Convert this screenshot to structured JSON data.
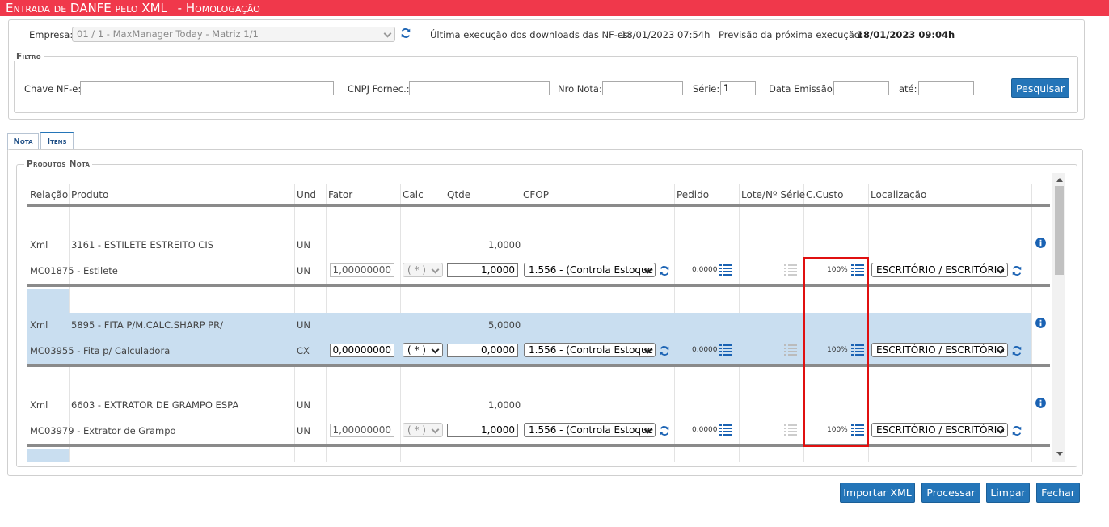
{
  "window": {
    "title": "Entrada de DANFE pelo XML",
    "env": "- Homologação"
  },
  "header": {
    "empresa_label": "Empresa:",
    "empresa_value": "01 / 1 - MaxManager Today - Matriz 1/1",
    "ultima_label": "Última execução dos downloads das NF-es:",
    "ultima_value": "18/01/2023 07:54h",
    "previsao_label": "Previsão da próxima execução:",
    "previsao_value": "18/01/2023 09:04h"
  },
  "filtro": {
    "legend": "Filtro",
    "chave_label": "Chave NF-e:",
    "chave_value": "",
    "cnpj_label": "CNPJ Fornec.:",
    "cnpj_value": "",
    "nro_label": "Nro Nota:",
    "nro_value": "",
    "serie_label": "Série:",
    "serie_value": "1",
    "data_label": "Data Emissão:",
    "data_value": "",
    "ate_label": "até:",
    "ate_value": "",
    "search_button": "Pesquisar"
  },
  "tabs": [
    {
      "label": "Nota",
      "active": false
    },
    {
      "label": "Itens",
      "active": true
    }
  ],
  "produtos": {
    "legend": "Produtos Nota",
    "columns": [
      "Relação",
      "Produto",
      "Und",
      "Fator",
      "Calc",
      "Qtde",
      "CFOP",
      "Pedido",
      "Lote/Nº Série",
      "C.Custo",
      "Localização"
    ],
    "items": [
      {
        "xml_relacao": "Xml",
        "xml_produto": "3161 - ESTILETE ESTREITO CIS",
        "xml_und": "UN",
        "xml_qtde": "1,0000",
        "rel": "MC01875 - Estilete",
        "und": "UN",
        "fator": "1,00000000",
        "calc": "( * )",
        "calc_disabled": true,
        "qtde": "1,0000",
        "cfop": "1.556 - (Controla Estoque",
        "pedido": "0,0000",
        "ccusto": "100%",
        "localizacao": "ESCRITÓRIO / ESCRITÓRIO",
        "highlight": false
      },
      {
        "xml_relacao": "Xml",
        "xml_produto": "5895 - FITA P/M.CALC.SHARP PR/",
        "xml_und": "UN",
        "xml_qtde": "5,0000",
        "rel": "MC03955 - Fita p/ Calculadora",
        "und": "CX",
        "fator": "0,00000000",
        "calc": "( * )",
        "calc_disabled": false,
        "qtde": "0,0000",
        "cfop": "1.556 - (Controla Estoque",
        "pedido": "0,0000",
        "ccusto": "100%",
        "localizacao": "ESCRITÓRIO / ESCRITÓRIO",
        "highlight": true
      },
      {
        "xml_relacao": "Xml",
        "xml_produto": "6603 - EXTRATOR DE GRAMPO ESPA",
        "xml_und": "UN",
        "xml_qtde": "1,0000",
        "rel": "MC03979 - Extrator de Grampo",
        "und": "UN",
        "fator": "1,00000000",
        "calc": "( * )",
        "calc_disabled": true,
        "qtde": "1,0000",
        "cfop": "1.556 - (Controla Estoque",
        "pedido": "0,0000",
        "ccusto": "100%",
        "localizacao": "ESCRITÓRIO / ESCRITÓRIO",
        "highlight": false
      }
    ]
  },
  "footer": {
    "importar": "Importar XML",
    "processar": "Processar",
    "limpar": "Limpar",
    "fechar": "Fechar"
  },
  "colors": {
    "titlebar": "#f0384b",
    "accent": "#2475b8",
    "row_highlight": "#c9def0",
    "annotation_box": "#e01010"
  }
}
